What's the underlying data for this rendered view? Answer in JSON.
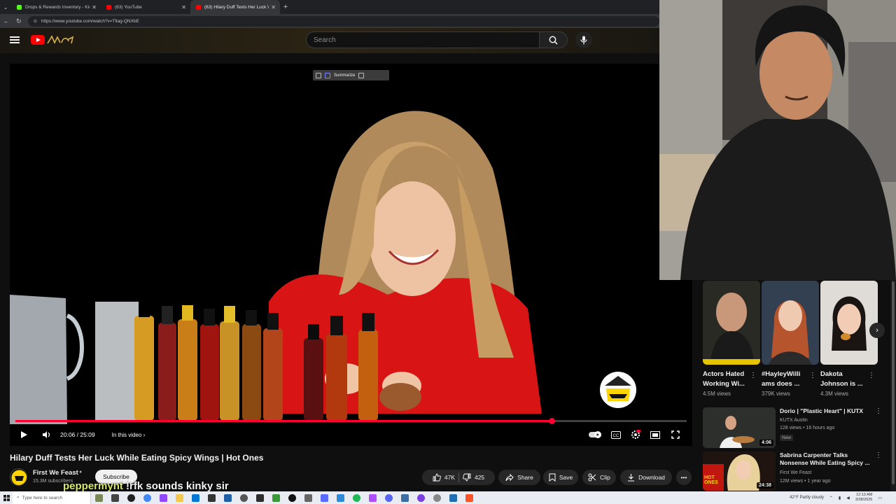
{
  "browser": {
    "tabs": [
      {
        "title": "Drops & Rewards Inventory - Kic",
        "active": false,
        "color": "#53fc18"
      },
      {
        "title": "(63) YouTube",
        "active": false,
        "color": "#ff0000"
      },
      {
        "title": "(63) Hilary Duff Tests Her Luck Wh",
        "active": true,
        "color": "#ff0000"
      }
    ],
    "url": "https://www.youtube.com/watch?v=Tllag-QNXbE"
  },
  "masthead": {
    "search_placeholder": "Search",
    "doodle_text": "ꓘꓘꓘ"
  },
  "player": {
    "extension_label": "Summarize",
    "time": "20:06 / 25:09",
    "chapters_label": "In this video",
    "progress": 0.7995
  },
  "video": {
    "title": "Hilary Duff Tests Her Luck While Eating Spicy Wings | Hot Ones",
    "channel": "First We Feast",
    "subscribers": "15.3M subscribers",
    "subscribe_label": "Subscribe",
    "likes": "47K",
    "dislikes": "425",
    "share_label": "Share",
    "save_label": "Save",
    "clip_label": "Clip",
    "download_label": "Download"
  },
  "overlay_caption": {
    "user": "peppermynt",
    "message": "!rfk sounds kinky sir"
  },
  "shorts": [
    {
      "title": "Actors Hated Working Wi...",
      "views": "4.5M views"
    },
    {
      "title": "#HayleyWilli ams does ...",
      "views": "379K views"
    },
    {
      "title": "Dakota Johnson is ...",
      "views": "4.3M views"
    }
  ],
  "recommendations": [
    {
      "title": "Dorio | \"Plastic Heart\" | KUTX",
      "channel": "KUTX Austin",
      "meta": "128 views • 16 hours ago",
      "badge": "New",
      "duration": "4:06"
    },
    {
      "title": "Sabrina Carpenter Talks Nonsense While Eating Spicy ...",
      "channel": "First We Feast",
      "meta": "12M views • 1 year ago",
      "badge": "",
      "duration": "24:38",
      "thumb_text": "HOT ONES"
    }
  ],
  "taskbar": {
    "search_placeholder": "Type here to search",
    "weather": "42°F  Partly cloudy",
    "time": "12:13 AM",
    "date": "3/28/2025"
  }
}
